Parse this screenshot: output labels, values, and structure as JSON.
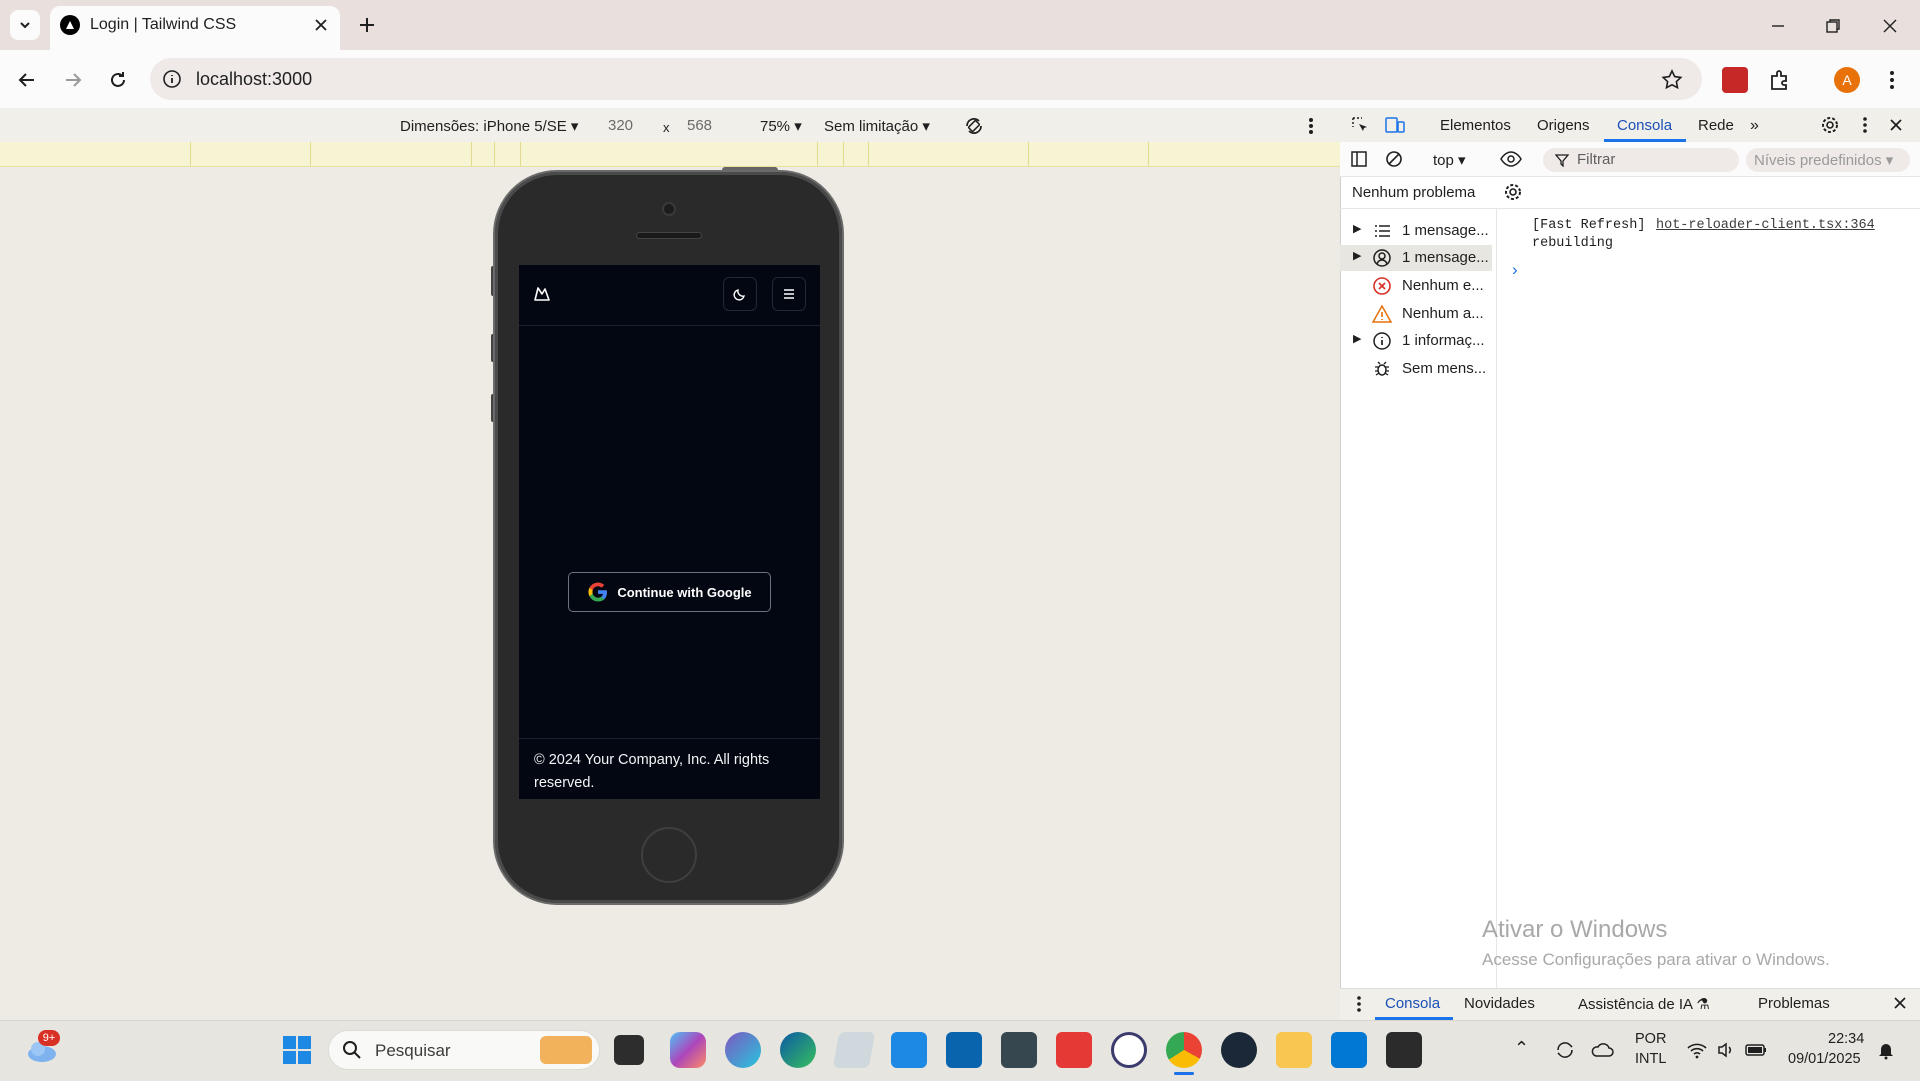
{
  "browser": {
    "tab_title": "Login | Tailwind CSS",
    "url": "localhost:3000"
  },
  "device_toolbar": {
    "dimensions": "Dimensões: iPhone 5/SE",
    "width": "320",
    "times": "x",
    "height": "568",
    "zoom": "75%",
    "throttle": "Sem limitação"
  },
  "app": {
    "google_button": "Continue with Google",
    "footer": "© 2024 Your Company, Inc. All rights reserved."
  },
  "devtools": {
    "tabs": [
      "Elementos",
      "Origens",
      "Consola",
      "Rede"
    ],
    "active_tab": "Consola",
    "context": "top",
    "filter_placeholder": "Filtrar",
    "levels": "Níveis predefinidos",
    "issues": "Nenhum problema",
    "sidebar": [
      {
        "label": "1 mensage...",
        "icon": "list-icon"
      },
      {
        "label": "1 mensage...",
        "icon": "user-icon"
      },
      {
        "label": "Nenhum e...",
        "icon": "error-icon"
      },
      {
        "label": "Nenhum a...",
        "icon": "warning-icon"
      },
      {
        "label": "1 informaç...",
        "icon": "info-icon"
      },
      {
        "label": "Sem mens...",
        "icon": "bug-icon"
      }
    ],
    "log": {
      "line1": "[Fast Refresh]",
      "link": "hot-reloader-client.tsx:364",
      "line2": "rebuilding"
    },
    "watermark_title": "Ativar o Windows",
    "watermark_sub": "Acesse Configurações para ativar o Windows.",
    "drawer_tabs": [
      "Consola",
      "Novidades",
      "Assistência de IA",
      "Problemas"
    ]
  },
  "taskbar": {
    "search_placeholder": "Pesquisar",
    "weather_badge": "9+",
    "lang_top": "POR",
    "lang_bottom": "INTL",
    "time": "22:34",
    "date": "09/01/2025"
  },
  "colors": {
    "app_bg": "#030712",
    "accent_blue": "#1a73e8",
    "profile": "#e8710a"
  }
}
